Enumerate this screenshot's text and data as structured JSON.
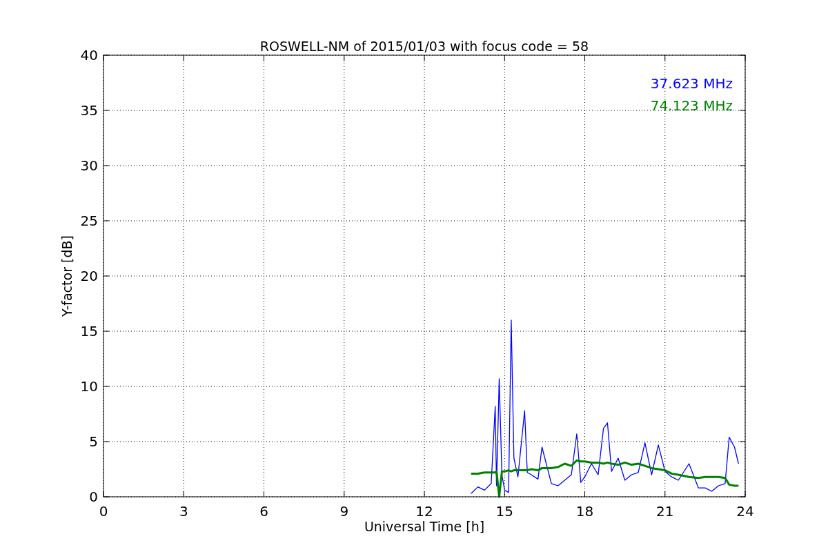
{
  "figure": {
    "chart_data": {
      "type": "line",
      "title": "ROSWELL-NM of 2015/01/03 with focus code = 58",
      "xlabel": "Universal Time [h]",
      "ylabel": "Y-factor [dB]",
      "x": [
        13.75,
        14.0,
        14.25,
        14.5,
        14.65,
        14.7,
        14.8,
        14.9,
        15.0,
        15.15,
        15.25,
        15.35,
        15.5,
        15.75,
        15.85,
        16.0,
        16.25,
        16.4,
        16.75,
        17.0,
        17.25,
        17.5,
        17.7,
        17.85,
        18.0,
        18.25,
        18.5,
        18.7,
        18.85,
        19.0,
        19.25,
        19.5,
        19.75,
        20.0,
        20.25,
        20.5,
        20.75,
        21.0,
        21.25,
        21.5,
        21.9,
        22.25,
        22.5,
        22.75,
        23.0,
        23.25,
        23.4,
        23.6,
        23.75
      ],
      "series": [
        {
          "name": "37.623 MHz",
          "color": "#0000ff",
          "values": [
            0.3,
            0.9,
            0.6,
            1.2,
            8.2,
            1.0,
            10.7,
            2.0,
            0.6,
            0.4,
            16.0,
            3.5,
            1.8,
            7.8,
            2.2,
            2.0,
            1.6,
            4.5,
            1.2,
            1.0,
            1.5,
            2.0,
            5.7,
            1.3,
            1.8,
            3.0,
            2.0,
            6.2,
            6.7,
            2.3,
            3.5,
            1.5,
            2.0,
            2.2,
            4.9,
            2.0,
            4.7,
            2.3,
            1.8,
            1.5,
            3.0,
            0.8,
            0.8,
            0.5,
            1.0,
            1.2,
            5.4,
            4.5,
            3.0
          ]
        },
        {
          "name": "74.123 MHz",
          "color": "#008000",
          "values": [
            2.1,
            2.1,
            2.2,
            2.2,
            2.2,
            2.3,
            0.0,
            2.3,
            2.3,
            2.4,
            2.3,
            2.4,
            2.4,
            2.4,
            2.4,
            2.5,
            2.4,
            2.6,
            2.6,
            2.7,
            3.0,
            2.8,
            3.3,
            3.2,
            3.2,
            3.1,
            3.1,
            3.0,
            3.1,
            3.0,
            2.9,
            3.1,
            2.9,
            3.0,
            2.8,
            2.6,
            2.5,
            2.4,
            2.1,
            2.0,
            1.8,
            1.7,
            1.8,
            1.8,
            1.8,
            1.7,
            1.1,
            1.0,
            1.0
          ]
        }
      ],
      "grid": true,
      "xlim": [
        0,
        24
      ],
      "ylim": [
        0,
        40
      ],
      "xticks": [
        0,
        3,
        6,
        9,
        12,
        15,
        18,
        21,
        24
      ],
      "yticks": [
        0,
        5,
        10,
        15,
        20,
        25,
        30,
        35,
        40
      ]
    }
  }
}
